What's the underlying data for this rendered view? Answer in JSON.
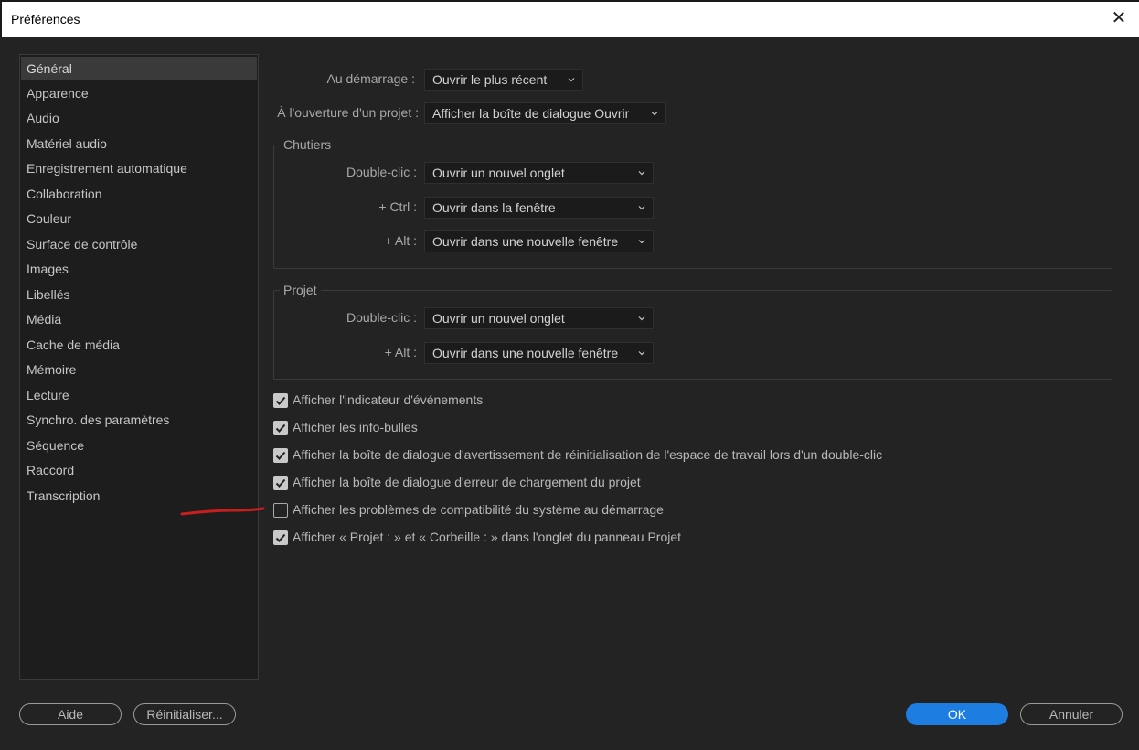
{
  "window": {
    "title": "Préférences",
    "close_glyph": "✕"
  },
  "sidebar": {
    "items": [
      {
        "label": "Général",
        "active": true
      },
      {
        "label": "Apparence"
      },
      {
        "label": "Audio"
      },
      {
        "label": "Matériel audio"
      },
      {
        "label": "Enregistrement automatique"
      },
      {
        "label": "Collaboration"
      },
      {
        "label": "Couleur"
      },
      {
        "label": "Surface de contrôle"
      },
      {
        "label": "Images"
      },
      {
        "label": "Libellés"
      },
      {
        "label": "Média"
      },
      {
        "label": "Cache de média"
      },
      {
        "label": "Mémoire"
      },
      {
        "label": "Lecture"
      },
      {
        "label": "Synchro. des paramètres"
      },
      {
        "label": "Séquence"
      },
      {
        "label": "Raccord"
      },
      {
        "label": "Transcription"
      }
    ]
  },
  "general": {
    "startup": {
      "label": "Au démarrage :",
      "value": "Ouvrir le plus récent"
    },
    "open_project": {
      "label": "À l'ouverture d'un projet :",
      "value": "Afficher la boîte de dialogue Ouvrir"
    }
  },
  "bins": {
    "title": "Chutiers",
    "double_click": {
      "label": "Double-clic :",
      "value": "Ouvrir un nouvel onglet"
    },
    "ctrl": {
      "label": "+ Ctrl :",
      "value": "Ouvrir dans la fenêtre"
    },
    "alt": {
      "label": "+ Alt :",
      "value": "Ouvrir dans une nouvelle fenêtre"
    }
  },
  "project": {
    "title": "Projet",
    "double_click": {
      "label": "Double-clic :",
      "value": "Ouvrir un nouvel onglet"
    },
    "alt": {
      "label": "+ Alt :",
      "value": "Ouvrir dans une nouvelle fenêtre"
    }
  },
  "checkboxes": [
    {
      "label": "Afficher l'indicateur d'événements",
      "checked": true
    },
    {
      "label": "Afficher les info-bulles",
      "checked": true
    },
    {
      "label": "Afficher la boîte de dialogue d'avertissement de réinitialisation de l'espace de travail lors d'un double-clic",
      "checked": true
    },
    {
      "label": "Afficher la boîte de dialogue d'erreur de chargement du projet",
      "checked": true
    },
    {
      "label": "Afficher les problèmes de compatibilité du système au démarrage",
      "checked": false
    },
    {
      "label": "Afficher « Projet : » et « Corbeille : » dans l'onglet du panneau Projet",
      "checked": true
    }
  ],
  "buttons": {
    "help": "Aide",
    "reset": "Réinitialiser...",
    "ok": "OK",
    "cancel": "Annuler"
  },
  "colors": {
    "accent": "#1e7de0",
    "annotation": "#c81e1e"
  }
}
